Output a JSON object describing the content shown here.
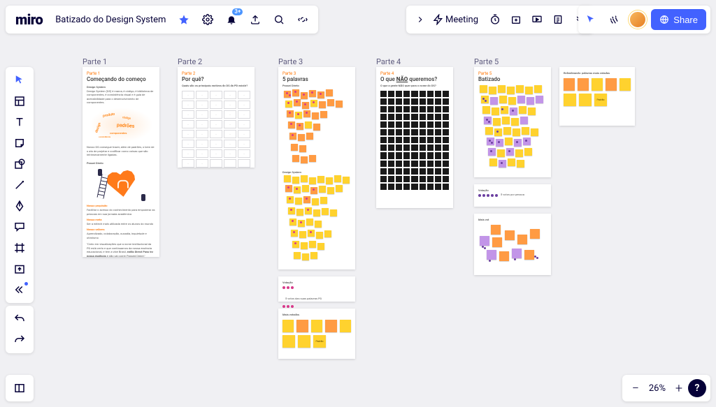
{
  "board": {
    "title": "Batizado do Design System"
  },
  "meeting": {
    "label": "Meeting"
  },
  "notifications": {
    "count": "3+"
  },
  "share": {
    "label": "Share"
  },
  "zoom": {
    "level": "26%"
  },
  "sections": {
    "p1": {
      "label": "Parte 1",
      "subtitle": "Parte 1",
      "title": "Começando do começo",
      "heading": "Design System",
      "subhead": "Passei Direto",
      "h_np": "Nosso propósito",
      "h_nm": "Nossa meta",
      "h_nv": "Nosso valores"
    },
    "p2": {
      "label": "Parte 2",
      "subtitle": "Parte 2",
      "title": "Por quê?",
      "subhead": "Quais são os principais motivos do DS da PD existir?"
    },
    "p3": {
      "label": "Parte 3",
      "subtitle": "Parte 3",
      "title": "5 palavras",
      "subhead": "Passei Direto",
      "ds": "Design System",
      "voting": "Votação",
      "most": "Mais votados",
      "word_padrao": "Padrão"
    },
    "p4": {
      "label": "Parte 4",
      "subtitle": "Parte 4",
      "title_pre": "O que ",
      "title_nao": "NÃO",
      "title_post": " queremos?",
      "subhead": "O que a gente NÃO quer para o nome do DS?"
    },
    "p5": {
      "label": "Parte 5",
      "subtitle": "Parte 5",
      "title": "Batizado",
      "voting": "Votação",
      "most": "Mais vot",
      "recall": "Relembrando: palavras mais votadas",
      "word_padrao": "Padrão"
    }
  },
  "wordcloud": [
    "produto",
    "design",
    "padrões",
    "componentes",
    "consistência",
    "código"
  ],
  "icons": {
    "star": "star-icon",
    "settings": "settings-icon",
    "bell": "bell-icon",
    "export": "export-icon",
    "search": "search-icon",
    "link": "link-icon",
    "chevron": "chevron-right-icon",
    "bolt": "bolt-icon",
    "timer": "timer-icon",
    "add_frame": "add-participant-icon",
    "present": "present-icon",
    "notes": "notes-icon",
    "more_v": "more-icon",
    "cursor2": "collab-cursor-icon",
    "confetti": "reactions-icon",
    "select": "select-tool-icon",
    "template": "templates-tool-icon",
    "text": "text-tool-icon",
    "sticky": "sticky-tool-icon",
    "shape": "shape-tool-icon",
    "line": "line-tool-icon",
    "pen": "pen-tool-icon",
    "comment": "comment-tool-icon",
    "frame": "frame-tool-icon",
    "upload": "upload-tool-icon",
    "more": "more-tools-icon",
    "undo": "undo-icon",
    "redo": "redo-icon",
    "map": "minimap-icon",
    "minus": "zoom-out-icon",
    "plus": "zoom-in-icon",
    "help": "help-icon",
    "globe": "globe-icon"
  }
}
